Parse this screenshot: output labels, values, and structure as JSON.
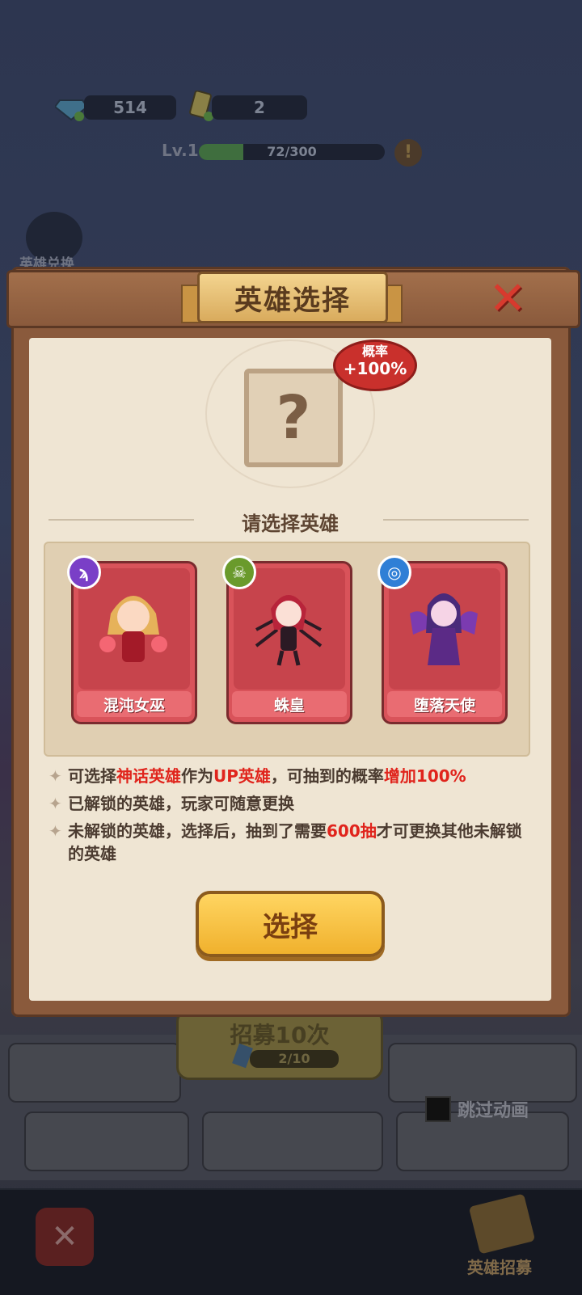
{
  "hud": {
    "gems": "514",
    "tickets": "2",
    "level": "Lv.1",
    "exp": "72/300",
    "exp_progress": 0.24
  },
  "background": {
    "hero_exchange_label": "英雄兑换",
    "recruit10_label": "招募10次",
    "recruit10_cost": "2/10",
    "skip_animation_label": "跳过动画",
    "hero_recruit_label": "英雄招募"
  },
  "dialog": {
    "title": "英雄选择",
    "rate_bubble_line1": "概率",
    "rate_bubble_line2": "+100%",
    "prompt": "请选择英雄",
    "heroes": [
      {
        "name": "混沌女巫",
        "badge_icon": "staff-icon",
        "badge_color": "#7a3fc7"
      },
      {
        "name": "蛛皇",
        "badge_icon": "skull-icon",
        "badge_color": "#6a9a2c"
      },
      {
        "name": "堕落天使",
        "badge_icon": "swirl-icon",
        "badge_color": "#2f7fd6"
      }
    ],
    "rules": [
      {
        "parts": [
          "可选择",
          "神话英雄",
          "作为",
          "UP英雄",
          "，可抽到的概率",
          "增加100%"
        ]
      },
      {
        "text": "已解锁的英雄，玩家可随意更换"
      },
      {
        "parts": [
          "未解锁的英雄，选择后，抽到了需要",
          "600抽",
          "才可更换其他未解锁的英雄"
        ]
      }
    ],
    "select_button": "选择"
  },
  "colors": {
    "accent_red": "#e0241c",
    "button_gold": "#f0b12d",
    "card_red": "#d9535a"
  }
}
